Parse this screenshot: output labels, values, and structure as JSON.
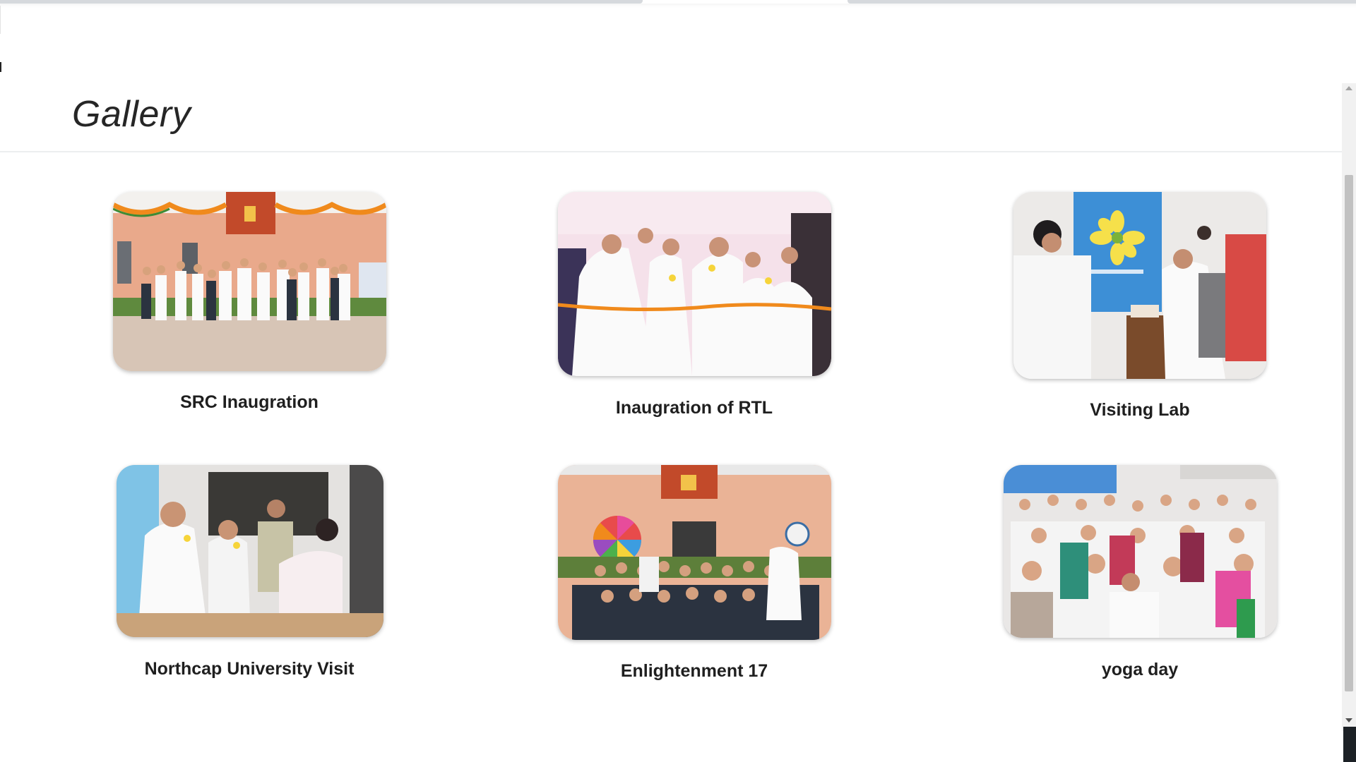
{
  "page": {
    "title": "Gallery"
  },
  "gallery": {
    "items": [
      {
        "caption": "SRC Inaugration"
      },
      {
        "caption": "Inaugration of RTL"
      },
      {
        "caption": "Visiting Lab"
      },
      {
        "caption": "Northcap University Visit"
      },
      {
        "caption": "Enlightenment 17"
      },
      {
        "caption": "yoga day"
      }
    ]
  },
  "colors": {
    "title": "#262626",
    "caption": "#1f1f1f",
    "divider": "#eceeef",
    "scroll_thumb": "#c1c1c1"
  }
}
